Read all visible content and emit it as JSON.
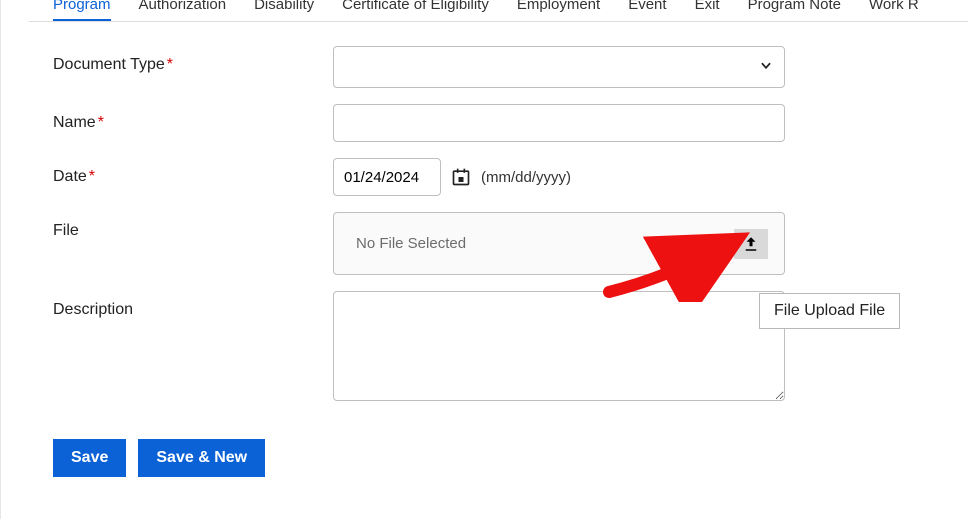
{
  "tabs": [
    {
      "label": "Program"
    },
    {
      "label": "Authorization"
    },
    {
      "label": "Disability"
    },
    {
      "label": "Certificate of Eligibility"
    },
    {
      "label": "Employment"
    },
    {
      "label": "Event"
    },
    {
      "label": "Exit"
    },
    {
      "label": "Program Note"
    },
    {
      "label": "Work R"
    }
  ],
  "labels": {
    "docType": "Document Type",
    "name": "Name",
    "date": "Date",
    "file": "File",
    "description": "Description"
  },
  "values": {
    "docType": "",
    "name": "",
    "date": "01/24/2024",
    "dateHint": "(mm/dd/yyyy)",
    "filePlaceholder": "No File Selected",
    "description": ""
  },
  "buttons": {
    "save": "Save",
    "saveNew": "Save & New"
  },
  "tooltip": "File Upload File"
}
